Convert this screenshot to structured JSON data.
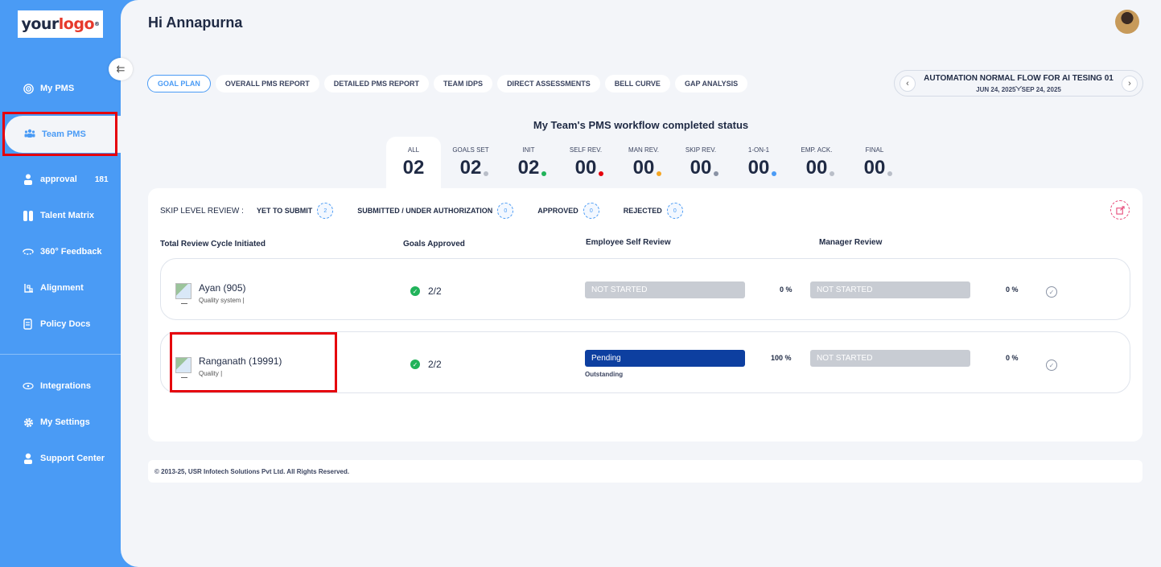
{
  "sidebar": {
    "logo": {
      "part1": "your",
      "part2": "logo",
      "mark": "®"
    },
    "items": [
      {
        "label": "My PMS",
        "icon": "target-icon"
      },
      {
        "label": "Team PMS",
        "icon": "team-icon"
      },
      {
        "label": "approval",
        "icon": "approval-icon",
        "count": "181"
      },
      {
        "label": "Talent Matrix",
        "icon": "matrix-icon"
      },
      {
        "label": "360° Feedback",
        "icon": "feedback-icon"
      },
      {
        "label": "Alignment",
        "icon": "alignment-icon"
      },
      {
        "label": "Policy Docs",
        "icon": "document-icon"
      },
      {
        "label": "Integrations",
        "icon": "integrations-icon"
      },
      {
        "label": "My Settings",
        "icon": "gear-icon"
      },
      {
        "label": "Support Center",
        "icon": "support-icon"
      }
    ],
    "collapse_icon": "⇇"
  },
  "header": {
    "greeting": "Hi Annapurna"
  },
  "tabs": [
    "GOAL PLAN",
    "OVERALL PMS REPORT",
    "DETAILED PMS REPORT",
    "TEAM IDPS",
    "DIRECT ASSESSMENTS",
    "BELL CURVE",
    "GAP ANALYSIS"
  ],
  "cycle": {
    "title": "AUTOMATION NORMAL FLOW FOR AI TESING 01",
    "dates": "JUN 24, 2025 - SEP 24, 2025",
    "prev": "‹",
    "next": "›",
    "caret": "⌵"
  },
  "workflow": {
    "title": "My Team's PMS workflow completed status",
    "stats": [
      {
        "label": "ALL",
        "value": "02",
        "dot": ""
      },
      {
        "label": "GOALS SET",
        "value": "02",
        "dot": "#b9bec8"
      },
      {
        "label": "INIT",
        "value": "02",
        "dot": "#21b35a"
      },
      {
        "label": "SELF REV.",
        "value": "00",
        "dot": "#e5000c"
      },
      {
        "label": "MAN REV.",
        "value": "00",
        "dot": "#f5a623"
      },
      {
        "label": "SKIP REV.",
        "value": "00",
        "dot": "#8a93a5"
      },
      {
        "label": "1-ON-1",
        "value": "00",
        "dot": "#4a9bf5"
      },
      {
        "label": "EMP. ACK.",
        "value": "00",
        "dot": "#b9bec8"
      },
      {
        "label": "FINAL",
        "value": "00",
        "dot": "#b9bec8"
      }
    ]
  },
  "skip_review": {
    "heading": "SKIP LEVEL REVIEW :",
    "items": [
      {
        "label": "YET TO SUBMIT",
        "count": "2"
      },
      {
        "label": "SUBMITTED / UNDER AUTHORIZATION",
        "count": "0"
      },
      {
        "label": "APPROVED",
        "count": "0"
      },
      {
        "label": "REJECTED",
        "count": "0"
      }
    ]
  },
  "table": {
    "headers": [
      "Total Review Cycle Initiated",
      "Goals Approved",
      "Employee Self Review",
      "Manager Review"
    ],
    "rows": [
      {
        "name": "Ayan (905)",
        "dept": "Quality system |",
        "goals": "2/2",
        "self_status": "NOT STARTED",
        "self_sub": "",
        "self_pct": "0 %",
        "mgr_status": "NOT STARTED",
        "mgr_pct": "0 %"
      },
      {
        "name": "Ranganath (19991)",
        "dept": "Quality |",
        "goals": "2/2",
        "self_status": "Pending",
        "self_sub": "Outstanding",
        "self_pct": "100 %",
        "mgr_status": "NOT STARTED",
        "mgr_pct": "0 %"
      }
    ]
  },
  "footer": {
    "text": "© 2013-25, USR Infotech Solutions Pvt Ltd. All Rights Reserved."
  }
}
